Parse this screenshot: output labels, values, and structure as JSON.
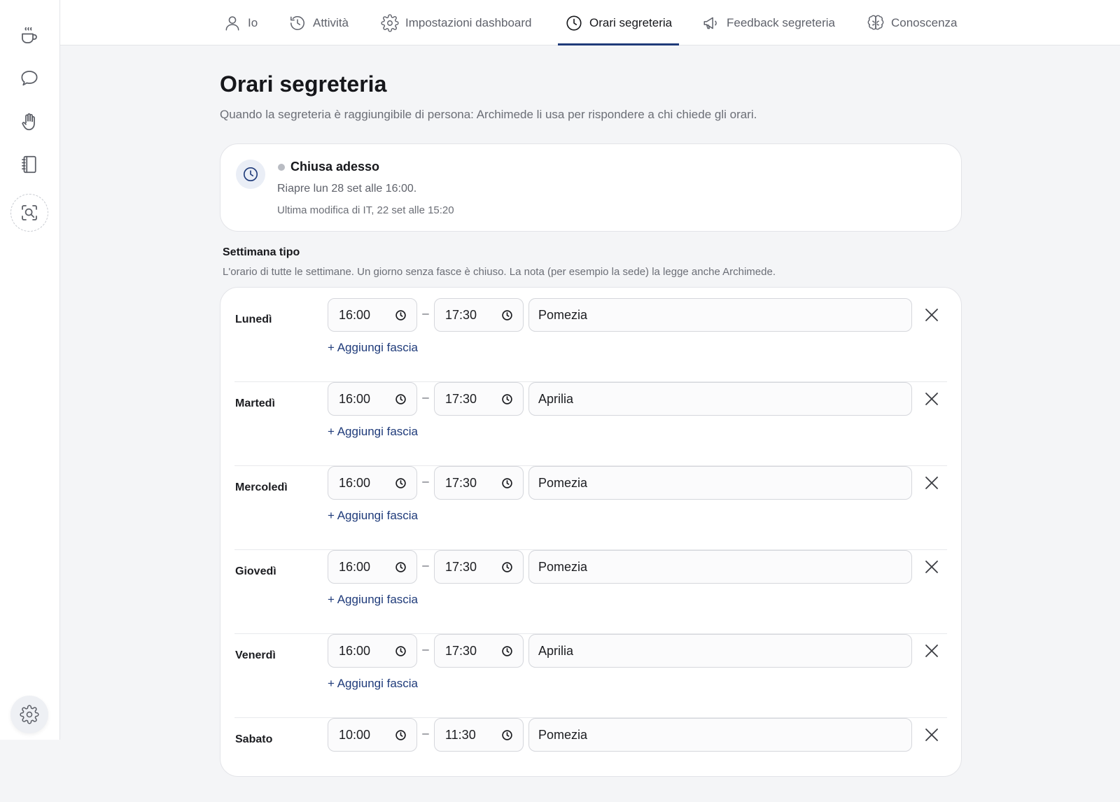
{
  "nav": {
    "tabs": [
      {
        "label": "Io",
        "icon": "user-icon",
        "active": false
      },
      {
        "label": "Attività",
        "icon": "history-clock-icon",
        "active": false
      },
      {
        "label": "Impostazioni dashboard",
        "icon": "gear-icon",
        "active": false
      },
      {
        "label": "Orari segreteria",
        "icon": "clock-icon",
        "active": true
      },
      {
        "label": "Feedback segreteria",
        "icon": "megaphone-icon",
        "active": false
      },
      {
        "label": "Conoscenza",
        "icon": "brain-icon",
        "active": false
      }
    ]
  },
  "sidebar": {
    "icons": [
      "coffee-cup-icon",
      "chat-bubble-icon",
      "hand-icon",
      "notebook-icon",
      "search-scan-icon",
      "gear-icon"
    ]
  },
  "page": {
    "title": "Orari segreteria",
    "subtitle": "Quando la segreteria è raggiungibile di persona: Archimede li usa per rispondere a chi chiede gli orari."
  },
  "status": {
    "title": "Chiusa adesso",
    "reopen": "Riapre lun 28 set alle 16:00.",
    "modified": "Ultima modifica di IT, 22 set alle 15:20",
    "dot_color": "#b9bcc3"
  },
  "week": {
    "title": "Settimana tipo",
    "description": "L'orario di tutte le settimane. Un giorno senza fasce è chiuso. La nota (per esempio la sede) la legge anche Archimede.",
    "separator": "–",
    "add_slot_label": "+ Aggiungi fascia",
    "days": [
      {
        "name": "Lunedì",
        "start": "16:00",
        "end": "17:30",
        "note": "Pomezia"
      },
      {
        "name": "Martedì",
        "start": "16:00",
        "end": "17:30",
        "note": "Aprilia"
      },
      {
        "name": "Mercoledì",
        "start": "16:00",
        "end": "17:30",
        "note": "Pomezia"
      },
      {
        "name": "Giovedì",
        "start": "16:00",
        "end": "17:30",
        "note": "Pomezia"
      },
      {
        "name": "Venerdì",
        "start": "16:00",
        "end": "17:30",
        "note": "Aprilia"
      },
      {
        "name": "Sabato",
        "start": "10:00",
        "end": "11:30",
        "note": "Pomezia"
      }
    ]
  },
  "colors": {
    "accent": "#1f3b7a",
    "background": "#f4f5f7",
    "card": "#ffffff"
  }
}
